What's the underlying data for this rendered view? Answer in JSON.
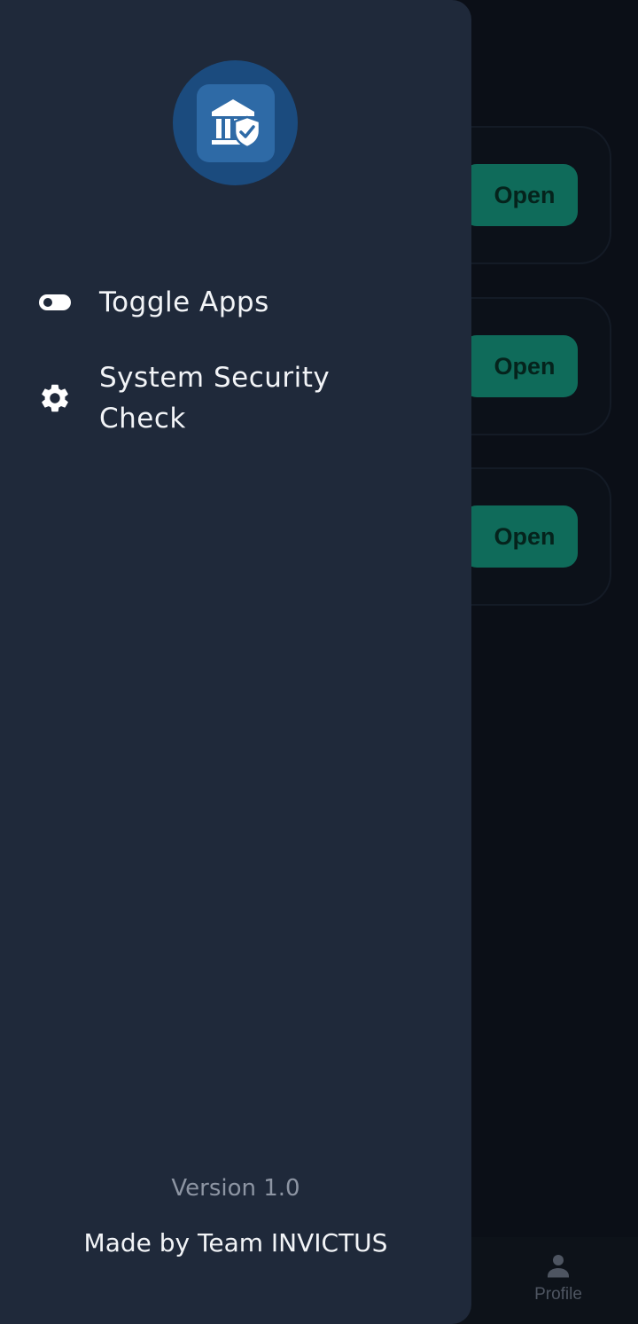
{
  "background": {
    "cards": [
      {
        "button_label": "Open"
      },
      {
        "button_label": "Open"
      },
      {
        "button_label": "Open"
      }
    ],
    "bottom_nav": {
      "profile_label": "Profile",
      "profile_icon": "person-icon"
    }
  },
  "drawer": {
    "logo_icon": "bank-shield-icon",
    "menu": [
      {
        "label": "Toggle Apps",
        "icon": "toggle-icon"
      },
      {
        "label": "System Security Check",
        "icon": "gear-icon"
      }
    ],
    "version": "Version 1.0",
    "credit": "Made by Team INVICTUS"
  },
  "colors": {
    "drawer_bg": "#1f293a",
    "accent_button": "#0f6b5a",
    "logo_bg": "#1b4b7e"
  }
}
